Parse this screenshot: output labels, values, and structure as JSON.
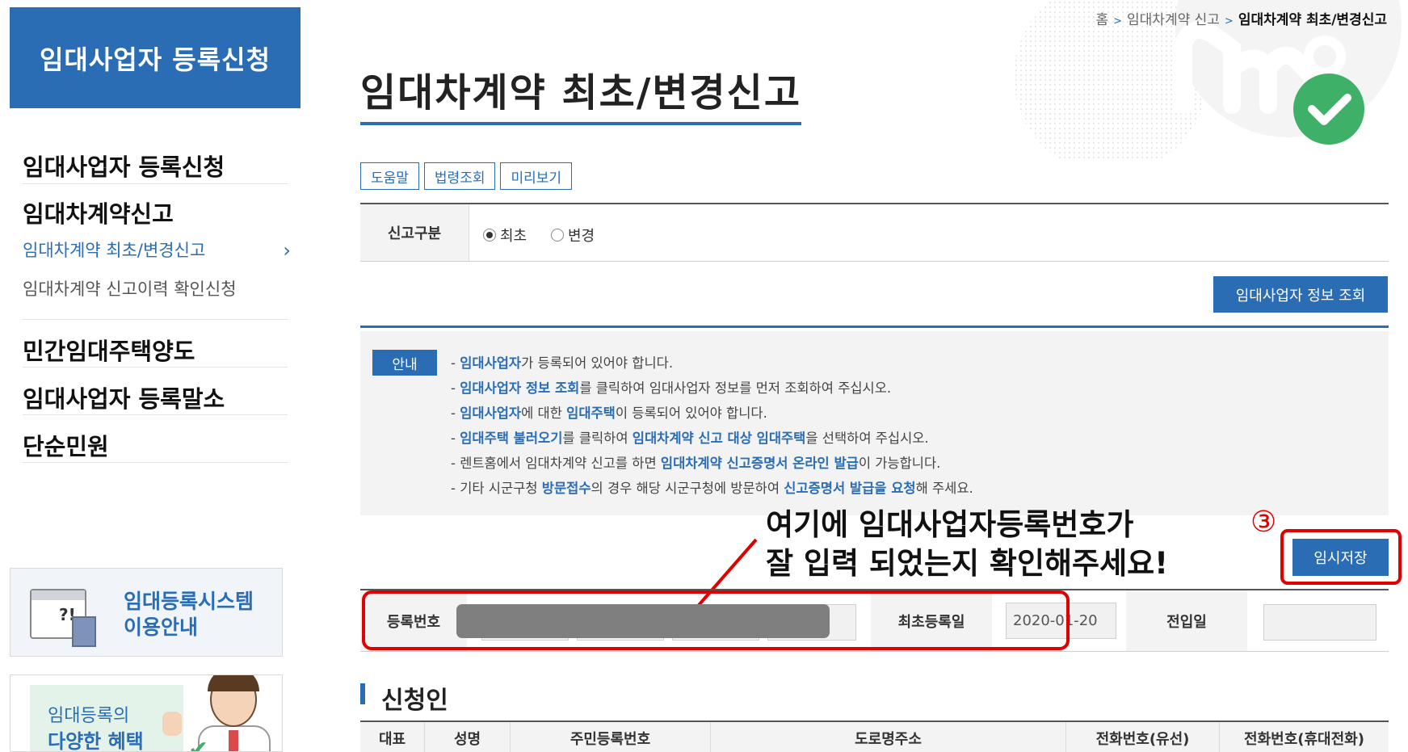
{
  "sidebar": {
    "header": "임대사업자 등록신청",
    "items": [
      {
        "label": "임대사업자 등록신청"
      },
      {
        "label": "임대차계약신고"
      },
      {
        "label": "민간임대주택양도"
      },
      {
        "label": "임대사업자 등록말소"
      },
      {
        "label": "단순민원"
      }
    ],
    "subitems": [
      {
        "label": "임대차계약 최초/변경신고",
        "active": true
      },
      {
        "label": "임대차계약 신고이력 확인신청",
        "active": false
      }
    ],
    "banner_guide": {
      "line1": "임대등록시스템",
      "line2": "이용안내"
    },
    "banner_benefit": {
      "line1": "임대등록의",
      "line2": "다양한 혜택"
    }
  },
  "breadcrumb": [
    "홈",
    "임대차계약 신고",
    "임대차계약 최초/변경신고"
  ],
  "page_title": "임대차계약 최초/변경신고",
  "tools": [
    "도움말",
    "법령조회",
    "미리보기"
  ],
  "report_type": {
    "label": "신고구분",
    "options": [
      {
        "label": "최초",
        "checked": true
      },
      {
        "label": "변경",
        "checked": false
      }
    ]
  },
  "lookup_button": "임대사업자 정보 조회",
  "notice": {
    "badge": "안내",
    "lines": [
      [
        {
          "t": "- "
        },
        {
          "t": "임대사업자",
          "hl": true
        },
        {
          "t": "가 등록되어 있어야 합니다."
        }
      ],
      [
        {
          "t": "- "
        },
        {
          "t": "임대사업자 정보 조회",
          "hl": true
        },
        {
          "t": "를 클릭하여 임대사업자 정보를 먼저 조회하여 주십시오."
        }
      ],
      [
        {
          "t": "- "
        },
        {
          "t": "임대사업자",
          "hl": true
        },
        {
          "t": "에 대한 "
        },
        {
          "t": "임대주택",
          "hl": true
        },
        {
          "t": "이 등록되어 있어야 합니다."
        }
      ],
      [
        {
          "t": "- "
        },
        {
          "t": "임대주택 불러오기",
          "hl": true
        },
        {
          "t": "를 클릭하여 "
        },
        {
          "t": "임대차계약 신고 대상 임대주택",
          "hl": true
        },
        {
          "t": "을 선택하여 주십시오."
        }
      ],
      [
        {
          "t": "- 렌트홈에서 임대차계약 신고를 하면 "
        },
        {
          "t": "임대차계약 신고증명서 온라인 발급",
          "hl": true
        },
        {
          "t": "이 가능합니다."
        }
      ],
      [
        {
          "t": "- 기타 시군구청 "
        },
        {
          "t": "방문접수",
          "hl": true
        },
        {
          "t": "의 경우 해당 시군구청에 방문하여 "
        },
        {
          "t": "신고증명서 발급을 요청",
          "hl": true
        },
        {
          "t": "해 주세요."
        }
      ]
    ]
  },
  "annotation": {
    "line1": "여기에 임대사업자등록번호가",
    "line2": "잘 입력 되었는지 확인해주세요!",
    "step": "③"
  },
  "save_button": "임시저장",
  "registration": {
    "reg_no_label": "등록번호",
    "first_reg_label": "최초등록일",
    "first_reg_value": "2020-01-20",
    "move_in_label": "전입일",
    "move_in_value": ""
  },
  "applicant": {
    "title": "신청인",
    "columns": [
      "대표",
      "성명",
      "주민등록번호",
      "도로명주소",
      "전화번호(유선)",
      "전화번호(휴대전화)"
    ]
  },
  "colors": {
    "accent": "#2b6db5",
    "highlight_red": "#e00000",
    "deco_green": "#3fb068"
  },
  "icons": [
    "chevron-right-icon",
    "guide-document-icon",
    "checkmark-icon",
    "arrow-icon"
  ]
}
